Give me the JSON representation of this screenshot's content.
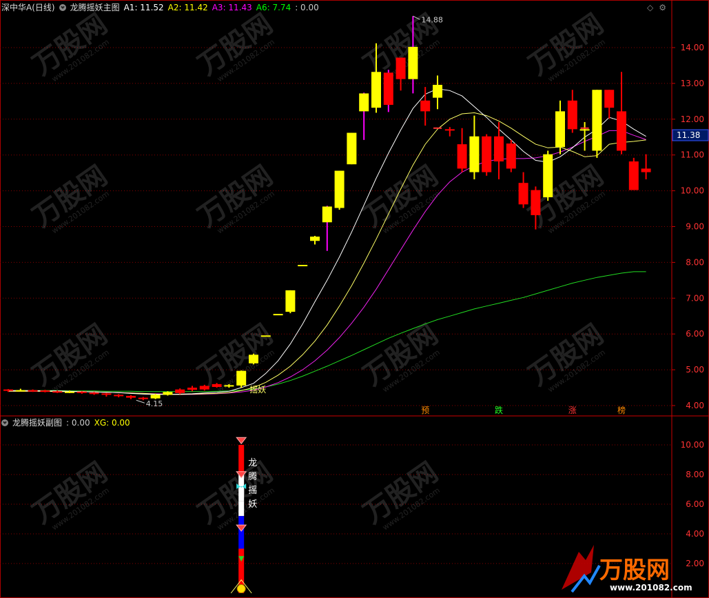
{
  "main_header": {
    "market": "深中华A(日线)",
    "indicator": "龙腾摇妖主图",
    "values": [
      {
        "label": "A1: 11.52",
        "color": "#ffffff"
      },
      {
        "label": "A2: 11.42",
        "color": "#ffff00"
      },
      {
        "label": "A3: 11.43",
        "color": "#ff00ff"
      },
      {
        "label": "A6: 7.74",
        "color": "#00ff00"
      },
      {
        "label": ": 0.00",
        "color": "#cccccc"
      }
    ]
  },
  "sub_header": {
    "indicator": "龙腾摇妖副图",
    "values": [
      {
        "label": ": 0.00",
        "color": "#cccccc"
      },
      {
        "label": "XG: 0.00",
        "color": "#ffff00"
      }
    ]
  },
  "window_icons": [
    "◇",
    "⚙"
  ],
  "price_axis": [
    "14.00",
    "13.00",
    "12.00",
    "11.00",
    "10.00",
    "9.00",
    "8.00",
    "7.00",
    "6.00",
    "5.00",
    "4.00"
  ],
  "current_price": "11.38",
  "sub_axis": [
    "10.00",
    "8.00",
    "6.00",
    "4.00",
    "2.00"
  ],
  "annotations": {
    "high": "14.88",
    "low": "4.15",
    "signal": "摇妖",
    "markers": [
      "预",
      "跌",
      "涨",
      "榜"
    ],
    "sub_vertical": [
      "龙",
      "腾",
      "摇",
      "妖"
    ]
  },
  "watermark": {
    "brand": "万股网",
    "site": "www.201082.com"
  },
  "colors": {
    "up": "#ffff00",
    "down": "#ff0000",
    "grid": "#7a0000",
    "axis": "#cc0000"
  },
  "chart_data": {
    "type": "candlestick",
    "y_range": [
      3.8,
      15.1
    ],
    "candles": [
      [
        4.45,
        4.42,
        4.46,
        4.38
      ],
      [
        4.42,
        4.43,
        4.47,
        4.4
      ],
      [
        4.43,
        4.42,
        4.45,
        4.38
      ],
      [
        4.42,
        4.4,
        4.44,
        4.37
      ],
      [
        4.4,
        4.38,
        4.42,
        4.35
      ],
      [
        4.38,
        4.39,
        4.42,
        4.35
      ],
      [
        4.39,
        4.36,
        4.4,
        4.33
      ],
      [
        4.36,
        4.34,
        4.38,
        4.3
      ],
      [
        4.34,
        4.3,
        4.35,
        4.25
      ],
      [
        4.3,
        4.27,
        4.32,
        4.23
      ],
      [
        4.27,
        4.22,
        4.29,
        4.18
      ],
      [
        4.22,
        4.2,
        4.24,
        4.15
      ],
      [
        4.2,
        4.3,
        4.33,
        4.18
      ],
      [
        4.3,
        4.38,
        4.4,
        4.28
      ],
      [
        4.45,
        4.35,
        4.48,
        4.32
      ],
      [
        4.5,
        4.44,
        4.55,
        4.4
      ],
      [
        4.55,
        4.45,
        4.58,
        4.42
      ],
      [
        4.6,
        4.52,
        4.63,
        4.5
      ],
      [
        4.55,
        4.57,
        4.6,
        4.5
      ],
      [
        4.56,
        4.97,
        4.98,
        4.5
      ],
      [
        5.18,
        5.42,
        5.45,
        5.15
      ],
      [
        5.96,
        5.96,
        5.96,
        5.96
      ],
      [
        6.56,
        6.56,
        6.56,
        6.56
      ],
      [
        6.62,
        7.22,
        7.22,
        6.58
      ],
      [
        7.93,
        7.93,
        7.93,
        7.93
      ],
      [
        8.6,
        8.72,
        8.74,
        8.5
      ],
      [
        9.12,
        9.56,
        9.58,
        8.32
      ],
      [
        9.52,
        10.56,
        10.56,
        9.47
      ],
      [
        10.74,
        11.62,
        11.62,
        10.74
      ],
      [
        12.22,
        12.72,
        12.74,
        11.42
      ],
      [
        12.32,
        13.32,
        14.12,
        12.18
      ],
      [
        13.3,
        12.4,
        13.38,
        12.2
      ],
      [
        13.72,
        13.12,
        13.72,
        12.8
      ],
      [
        13.12,
        14.02,
        14.88,
        12.72
      ],
      [
        12.52,
        12.22,
        12.9,
        11.82
      ],
      [
        12.6,
        12.96,
        13.22,
        12.28
      ],
      [
        11.72,
        11.7,
        11.78,
        11.52
      ],
      [
        11.3,
        10.62,
        11.75,
        10.52
      ],
      [
        10.52,
        11.52,
        12.1,
        10.32
      ],
      [
        11.52,
        10.52,
        11.58,
        10.42
      ],
      [
        11.52,
        10.82,
        11.92,
        10.32
      ],
      [
        11.32,
        10.62,
        11.42,
        10.52
      ],
      [
        10.22,
        9.62,
        10.52,
        9.52
      ],
      [
        10.02,
        9.32,
        10.12,
        8.92
      ],
      [
        9.82,
        11.02,
        11.12,
        9.72
      ],
      [
        11.22,
        12.22,
        12.52,
        11.02
      ],
      [
        12.52,
        11.72,
        12.82,
        11.62
      ],
      [
        11.72,
        11.72,
        11.92,
        11.12
      ],
      [
        11.12,
        12.82,
        12.82,
        10.92
      ],
      [
        12.82,
        12.32,
        12.82,
        12.02
      ],
      [
        12.22,
        11.12,
        13.32,
        11.02
      ],
      [
        10.82,
        10.02,
        10.92,
        10.02
      ],
      [
        10.62,
        10.52,
        11.02,
        10.32
      ]
    ],
    "ma_white": [
      4.42,
      4.42,
      4.42,
      4.41,
      4.41,
      4.4,
      4.39,
      4.38,
      4.37,
      4.36,
      4.34,
      4.32,
      4.31,
      4.31,
      4.32,
      4.33,
      4.35,
      4.37,
      4.4,
      4.5,
      4.62,
      4.9,
      5.25,
      5.72,
      6.28,
      6.9,
      7.5,
      8.15,
      8.85,
      9.6,
      10.35,
      11.05,
      11.7,
      12.3,
      12.7,
      12.85,
      12.8,
      12.65,
      12.35,
      12.05,
      11.72,
      11.42,
      11.1,
      10.85,
      10.8,
      10.95,
      11.2,
      11.5,
      11.72,
      12.05,
      11.95,
      11.72,
      11.52
    ],
    "ma_yellow": [
      4.4,
      4.4,
      4.4,
      4.4,
      4.39,
      4.39,
      4.39,
      4.38,
      4.37,
      4.36,
      4.35,
      4.34,
      4.32,
      4.31,
      4.31,
      4.32,
      4.33,
      4.34,
      4.36,
      4.42,
      4.5,
      4.65,
      4.85,
      5.1,
      5.42,
      5.8,
      6.25,
      6.78,
      7.35,
      7.98,
      8.65,
      9.35,
      10.05,
      10.72,
      11.3,
      11.72,
      12.0,
      12.15,
      12.18,
      12.1,
      11.95,
      11.75,
      11.52,
      11.3,
      11.2,
      11.22,
      11.1,
      10.95,
      10.98,
      11.3,
      11.35,
      11.38,
      11.42
    ],
    "ma_magenta": [
      4.4,
      4.4,
      4.4,
      4.4,
      4.39,
      4.39,
      4.39,
      4.38,
      4.37,
      4.36,
      4.35,
      4.34,
      4.33,
      4.32,
      4.31,
      4.31,
      4.32,
      4.33,
      4.35,
      4.38,
      4.43,
      4.52,
      4.64,
      4.8,
      5.0,
      5.25,
      5.55,
      5.9,
      6.3,
      6.75,
      7.25,
      7.8,
      8.35,
      8.9,
      9.42,
      9.88,
      10.25,
      10.52,
      10.7,
      10.82,
      10.88,
      10.9,
      10.9,
      10.92,
      10.98,
      11.08,
      11.22,
      11.38,
      11.52,
      11.68,
      11.68,
      11.55,
      11.43
    ],
    "ma_green": [
      4.42,
      4.42,
      4.42,
      4.42,
      4.42,
      4.41,
      4.41,
      4.41,
      4.4,
      4.4,
      4.4,
      4.39,
      4.39,
      4.39,
      4.39,
      4.39,
      4.39,
      4.4,
      4.41,
      4.43,
      4.46,
      4.52,
      4.6,
      4.7,
      4.82,
      4.96,
      5.1,
      5.25,
      5.4,
      5.56,
      5.72,
      5.88,
      6.02,
      6.15,
      6.28,
      6.4,
      6.5,
      6.6,
      6.7,
      6.78,
      6.86,
      6.94,
      7.02,
      7.12,
      7.22,
      7.32,
      7.42,
      7.5,
      7.58,
      7.64,
      7.7,
      7.74,
      7.74
    ],
    "sub_bar": {
      "x_index": 19,
      "top": 10.0,
      "bottom": 0.0
    }
  }
}
